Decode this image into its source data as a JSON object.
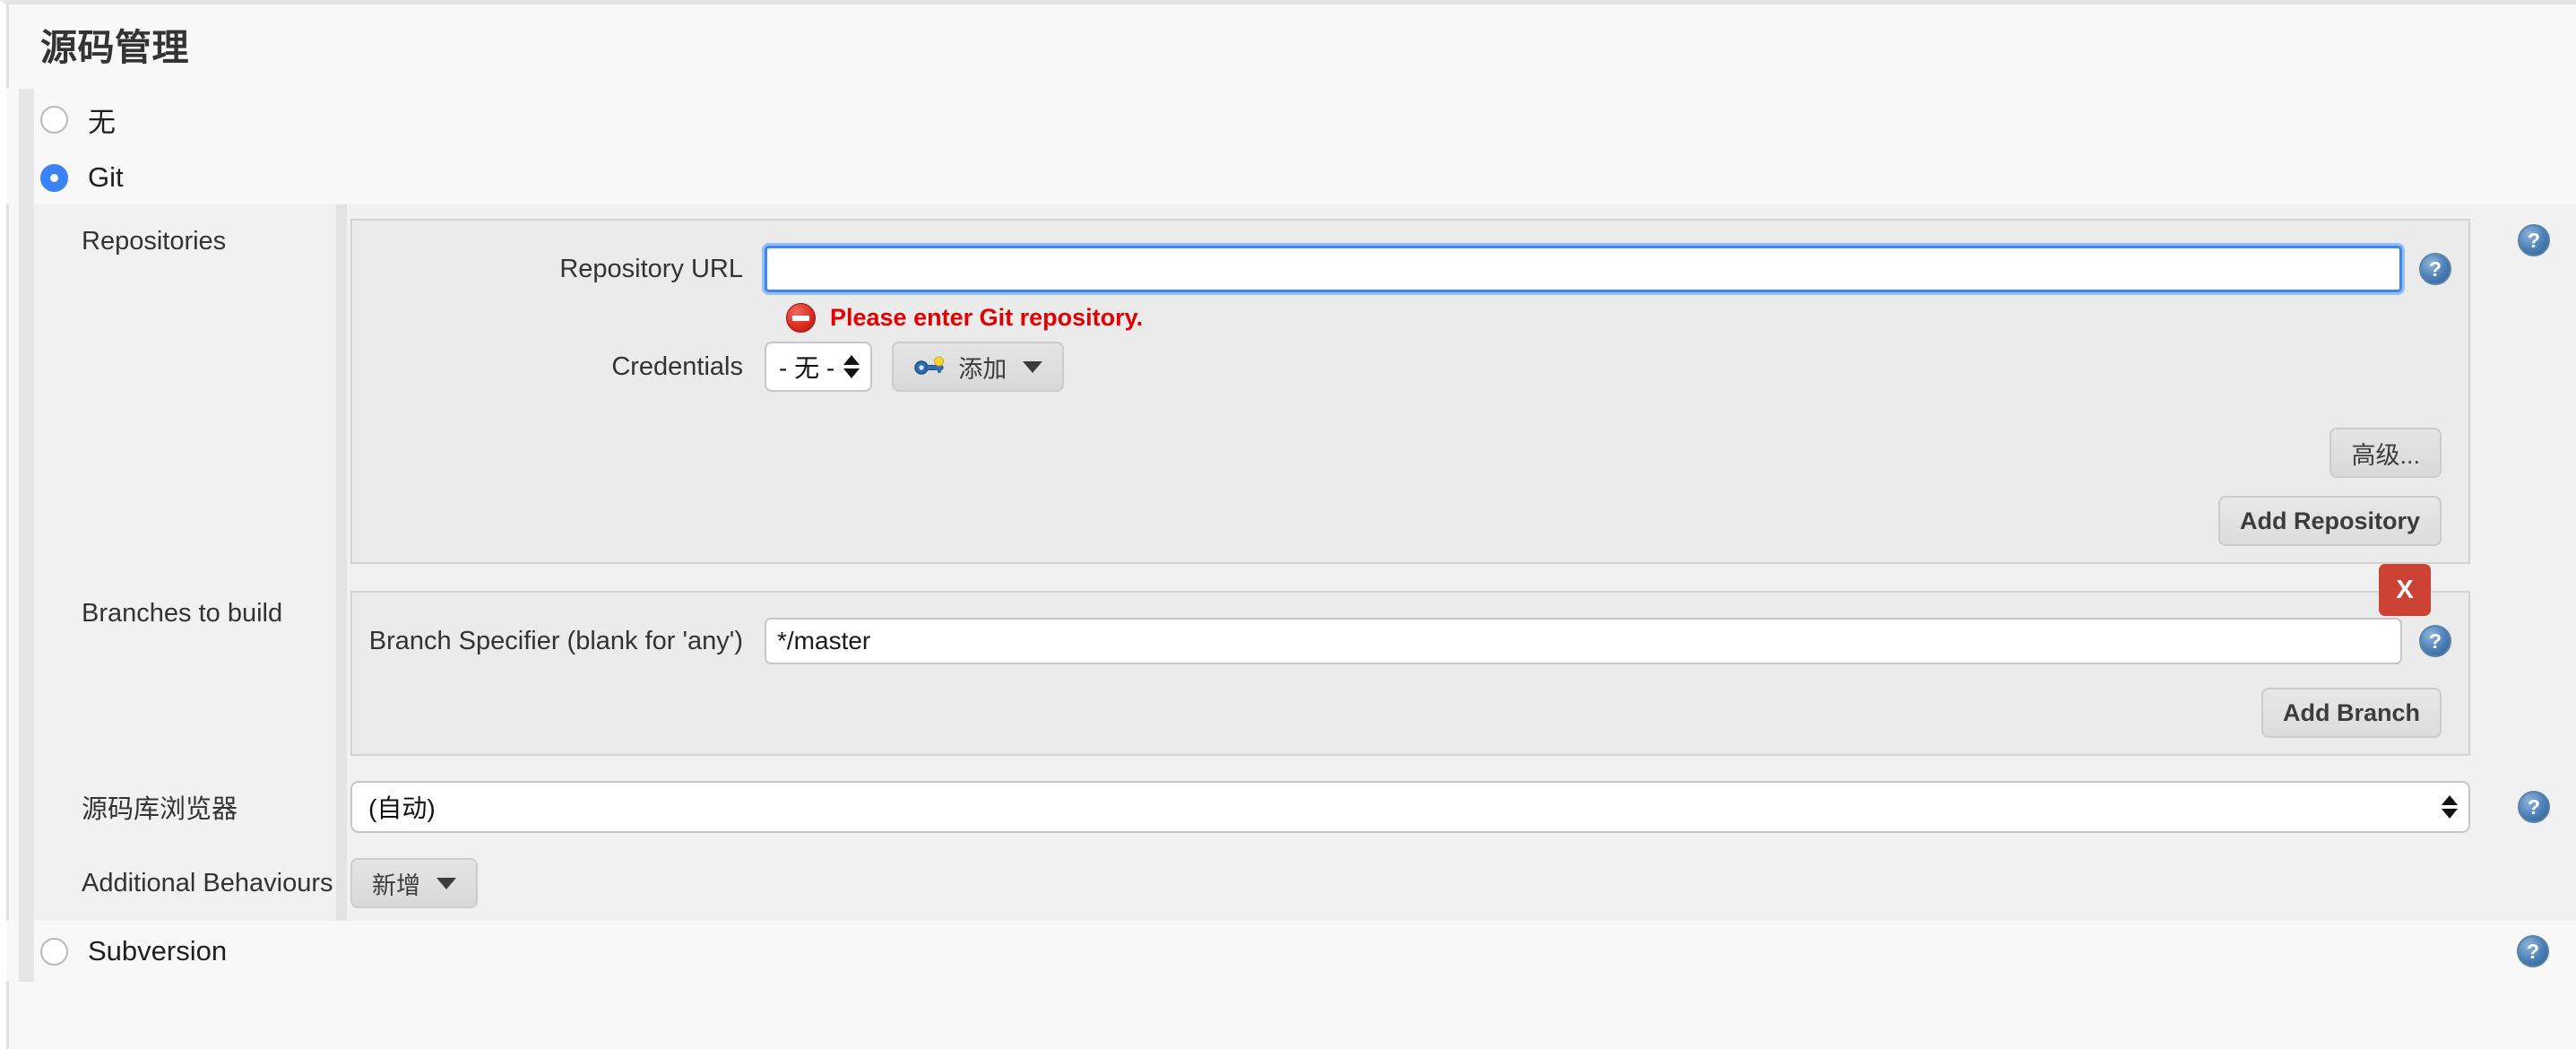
{
  "page": {
    "title": "源码管理"
  },
  "scm_options": [
    {
      "label": "无",
      "selected": false,
      "name": "scm-none"
    },
    {
      "label": "Git",
      "selected": true,
      "name": "scm-git"
    },
    {
      "label": "Subversion",
      "selected": false,
      "name": "scm-subversion"
    }
  ],
  "git": {
    "repositories": {
      "section_label": "Repositories",
      "url_field": {
        "label": "Repository URL",
        "value": "",
        "focused": true
      },
      "error": {
        "text": "Please enter Git repository.",
        "color": "#e30000",
        "icon": "error-circle-icon"
      },
      "credentials": {
        "label": "Credentials",
        "selected": "- 无 -",
        "add_button": "添加",
        "add_icon": "key-icon"
      },
      "advanced_button": "高级...",
      "add_repository_button": "Add Repository"
    },
    "branches": {
      "section_label": "Branches to build",
      "specifier": {
        "label": "Branch Specifier (blank for 'any')",
        "value": "*/master"
      },
      "delete_button": "X",
      "delete_button_color": "#cc4335",
      "add_branch_button": "Add Branch"
    },
    "repository_browser": {
      "label": "源码库浏览器",
      "selected": "(自动)"
    },
    "additional_behaviours": {
      "label": "Additional Behaviours",
      "add_button": "新增"
    }
  },
  "icons": {
    "help": "?",
    "help_name": "help-icon"
  }
}
